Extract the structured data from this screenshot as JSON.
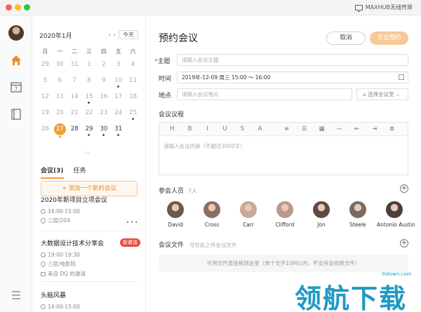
{
  "window": {
    "cast_label": "MAXHUB无线传屏"
  },
  "calendar": {
    "month_label": "2020年1月",
    "prev": "‹",
    "next": "›",
    "today": "今天",
    "weekdays": [
      "日",
      "一",
      "二",
      "三",
      "四",
      "五",
      "六"
    ],
    "days": [
      {
        "n": "29",
        "cur": false,
        "mark": false
      },
      {
        "n": "30",
        "cur": false,
        "mark": false
      },
      {
        "n": "31",
        "cur": false,
        "mark": false
      },
      {
        "n": "1",
        "cur": false,
        "mark": false
      },
      {
        "n": "2",
        "cur": false,
        "mark": false
      },
      {
        "n": "3",
        "cur": false,
        "mark": false
      },
      {
        "n": "4",
        "cur": false,
        "mark": false
      },
      {
        "n": "5",
        "cur": false,
        "mark": false
      },
      {
        "n": "6",
        "cur": false,
        "mark": false
      },
      {
        "n": "7",
        "cur": false,
        "mark": false
      },
      {
        "n": "8",
        "cur": false,
        "mark": false
      },
      {
        "n": "9",
        "cur": false,
        "mark": false
      },
      {
        "n": "10",
        "cur": false,
        "mark": true
      },
      {
        "n": "11",
        "cur": false,
        "mark": false
      },
      {
        "n": "12",
        "cur": false,
        "mark": false
      },
      {
        "n": "13",
        "cur": false,
        "mark": false
      },
      {
        "n": "14",
        "cur": false,
        "mark": false
      },
      {
        "n": "15",
        "cur": false,
        "mark": true
      },
      {
        "n": "16",
        "cur": false,
        "mark": false
      },
      {
        "n": "17",
        "cur": false,
        "mark": false
      },
      {
        "n": "18",
        "cur": false,
        "mark": false
      },
      {
        "n": "19",
        "cur": false,
        "mark": false
      },
      {
        "n": "20",
        "cur": false,
        "mark": false
      },
      {
        "n": "21",
        "cur": false,
        "mark": false
      },
      {
        "n": "22",
        "cur": false,
        "mark": false
      },
      {
        "n": "23",
        "cur": false,
        "mark": false
      },
      {
        "n": "24",
        "cur": false,
        "mark": false
      },
      {
        "n": "25",
        "cur": false,
        "mark": true
      },
      {
        "n": "26",
        "cur": false,
        "mark": false
      },
      {
        "n": "27",
        "cur": true,
        "mark": true,
        "sel": true
      },
      {
        "n": "28",
        "cur": true,
        "mark": false
      },
      {
        "n": "29",
        "cur": true,
        "mark": true
      },
      {
        "n": "30",
        "cur": true,
        "mark": true
      },
      {
        "n": "31",
        "cur": true,
        "mark": true
      }
    ]
  },
  "list_tabs": {
    "meetings": "会议(3)",
    "tasks": "任务"
  },
  "add_meeting": "+ 添加一个新的会议",
  "meetings": [
    {
      "title": "2020年新项目立项会议",
      "time": "14:00-15:00",
      "place": "二层/204",
      "more": "•••"
    },
    {
      "title": "大数据设计技术分享会",
      "badge": "新邀请",
      "time": "19:00-19:30",
      "place": "三层/电影院",
      "inviter": "来自 DQ 的邀请"
    },
    {
      "title": "头脑风暴",
      "time": "14:00-15:00"
    }
  ],
  "form": {
    "title": "预约会议",
    "cancel": "取消",
    "send": "发出预约",
    "subject_label": "主题",
    "subject_required": "*",
    "subject_placeholder": "请输入会议主题",
    "time_label": "时间",
    "time_value": "2019年-12-09 周三 15:00 ～ 16:00",
    "place_label": "地点",
    "place_placeholder": "请输入会议地点",
    "room_button": "选择会议室",
    "agenda_label": "会议议程",
    "agenda_placeholder": "请输入会议内容（不超过3000字）",
    "toolbar": [
      "H",
      "B",
      "I",
      "U",
      "S",
      "A",
      "≡",
      "☰",
      "▦",
      "—",
      "⇤",
      "⇥",
      "≣"
    ],
    "attendees_label": "参会人员",
    "attendees_count": "7人",
    "files_label": "会议文件",
    "files_hint": "可在此上传会议文件",
    "drop_hint": "可将文件直接拖到这里（单个文件10M以内，不支持音视频文件）"
  },
  "attendees": [
    {
      "name": "David",
      "color": "#6b5a52"
    },
    {
      "name": "Cross",
      "color": "#8a6f63"
    },
    {
      "name": "Carr",
      "color": "#c9a79a"
    },
    {
      "name": "Clifford",
      "color": "#b89a8c"
    },
    {
      "name": "Jon",
      "color": "#5d4a44"
    },
    {
      "name": "Steele",
      "color": "#7b6a62"
    },
    {
      "name": "Antonio Austin",
      "color": "#4e3f3a"
    }
  ],
  "watermark": {
    "url": "lhdown.com",
    "text": "领航下载"
  }
}
